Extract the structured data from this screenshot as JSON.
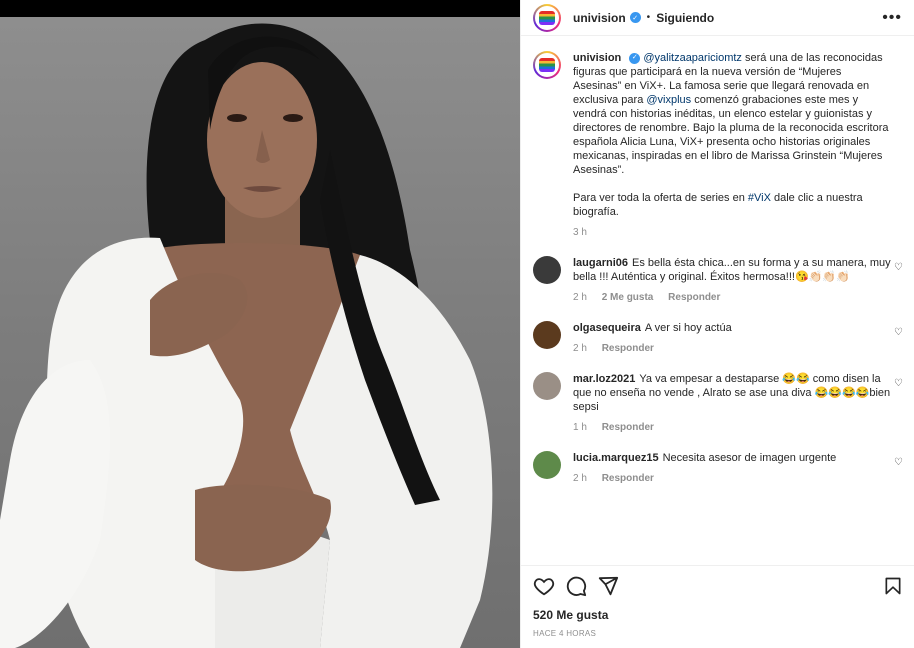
{
  "post": {
    "author": "univision",
    "follow_state": "Siguiendo",
    "more": "•••",
    "caption": {
      "mention": "@yalitzaapariciomtz",
      "text1": " será una de las reconocidas figuras que participará en la nueva versión de “Mujeres Asesinas” en ViX+. La famosa serie que llegará renovada en exclusiva para ",
      "mention2": "@vixplus",
      "text2": " comenzó grabaciones este mes y vendrá con historias inéditas, un elenco estelar y guionistas y directores de renombre. Bajo la pluma de la reconocida escritora española Alicia Luna, ViX+ presenta ocho historias originales mexicanas, inspiradas en el libro de Marissa Grinstein “Mujeres Asesinas”.",
      "text3": "Para ver toda la oferta de series en ",
      "hashtag": "#ViX",
      "text4": " dale clic a nuestra biografía.",
      "time": "3 h"
    },
    "likes": "520 Me gusta",
    "posted": "HACE 4 HORAS"
  },
  "comments": [
    {
      "user": "laugarni06",
      "text": "Es bella ésta chica...en su forma y a su manera, muy bella !!! Auténtica y original. Éxitos hermosa!!!😘👏🏻👏🏻👏🏻",
      "time": "2 h",
      "likes": "2 Me gusta",
      "reply": "Responder",
      "avatar_color": "#3a3a3a"
    },
    {
      "user": "olgasequeira",
      "text": "A ver si hoy actúa",
      "time": "2 h",
      "reply": "Responder",
      "avatar_color": "#5b3a1e"
    },
    {
      "user": "mar.loz2021",
      "text": "Ya va empesar a destaparse 😂😂 como disen la que no enseña no vende , Alrato se ase una diva 😂😂😂😂bien sepsi",
      "time": "1 h",
      "reply": "Responder",
      "avatar_color": "#9a8f86"
    },
    {
      "user": "lucia.marquez15",
      "text": "Necesita asesor de imagen urgente",
      "time": "2 h",
      "reply": "Responder",
      "avatar_color": "#5e8a4a"
    }
  ],
  "icons": {
    "heart": "heart-icon",
    "comment": "comment-icon",
    "share": "share-icon",
    "save": "bookmark-icon"
  }
}
